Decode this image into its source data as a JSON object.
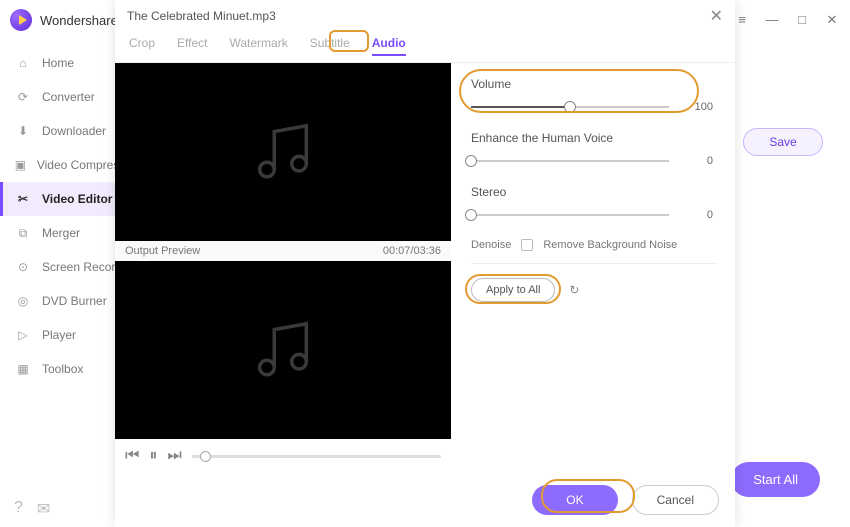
{
  "app": {
    "title": "Wondershare UniConverter"
  },
  "win_ctrls": {
    "menu": "≡",
    "min": "—",
    "max": "□",
    "close": "✕"
  },
  "sidebar": {
    "items": [
      {
        "label": "Home"
      },
      {
        "label": "Converter"
      },
      {
        "label": "Downloader"
      },
      {
        "label": "Video Compressor"
      },
      {
        "label": "Video Editor"
      },
      {
        "label": "Merger"
      },
      {
        "label": "Screen Recorder"
      },
      {
        "label": "DVD Burner"
      },
      {
        "label": "Player"
      },
      {
        "label": "Toolbox"
      }
    ]
  },
  "main": {
    "save": "Save",
    "start_all": "Start All"
  },
  "modal": {
    "file": "The Celebrated Minuet.mp3",
    "close": "✕",
    "tabs": {
      "crop": "Crop",
      "effect": "Effect",
      "watermark": "Watermark",
      "subtitle": "Subtitle",
      "audio": "Audio"
    },
    "output_label": "Output Preview",
    "time": "00:07/03:36",
    "audio": {
      "volume_label": "Volume",
      "volume_value": "100",
      "enhance_label": "Enhance the Human Voice",
      "enhance_value": "0",
      "stereo_label": "Stereo",
      "stereo_value": "0",
      "denoise_label": "Denoise",
      "denoise_opt": "Remove Background Noise",
      "apply_all": "Apply to All"
    },
    "ok": "OK",
    "cancel": "Cancel"
  }
}
